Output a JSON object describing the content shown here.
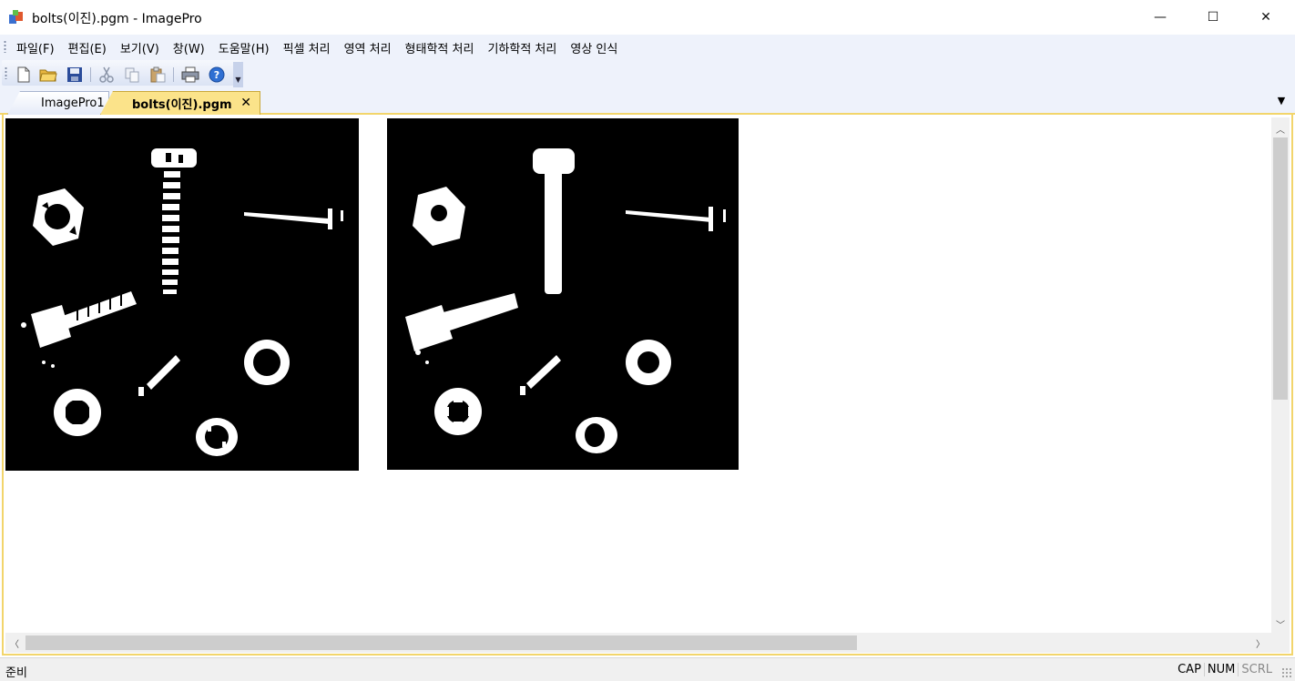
{
  "window": {
    "title": "bolts(이진).pgm - ImagePro",
    "minimize_glyph": "—",
    "maximize_glyph": "☐",
    "close_glyph": "✕"
  },
  "menu": {
    "items": [
      {
        "label": "파일(F)"
      },
      {
        "label": "편집(E)"
      },
      {
        "label": "보기(V)"
      },
      {
        "label": "창(W)"
      },
      {
        "label": "도움말(H)"
      },
      {
        "label": "픽셀 처리"
      },
      {
        "label": "영역 처리"
      },
      {
        "label": "형태학적 처리"
      },
      {
        "label": "기하학적 처리"
      },
      {
        "label": "영상 인식"
      }
    ]
  },
  "toolbar": {
    "buttons": [
      {
        "icon": "new-document-icon"
      },
      {
        "icon": "open-folder-icon"
      },
      {
        "icon": "save-disk-icon"
      },
      {
        "icon": "cut-icon"
      },
      {
        "icon": "copy-icon"
      },
      {
        "icon": "paste-icon"
      },
      {
        "icon": "print-icon"
      },
      {
        "icon": "help-icon"
      }
    ]
  },
  "tabs": [
    {
      "label": "ImagePro1",
      "active": false
    },
    {
      "label": "bolts(이진).pgm",
      "active": true
    }
  ],
  "tab_close_glyph": "✕",
  "tab_dropdown_glyph": "▼",
  "scroll": {
    "up": "︿",
    "down": "﹀",
    "left": "〈",
    "right": "〉"
  },
  "status": {
    "text": "준비",
    "indicators": [
      {
        "label": "CAP",
        "active": true
      },
      {
        "label": "NUM",
        "active": true
      },
      {
        "label": "SCRL",
        "active": false
      }
    ]
  },
  "colors": {
    "tab_active": "#fbe38a",
    "frame_accent": "#f2d56b",
    "menu_background": "#eef2fb",
    "image_background": "#000000",
    "image_foreground": "#ffffff"
  }
}
